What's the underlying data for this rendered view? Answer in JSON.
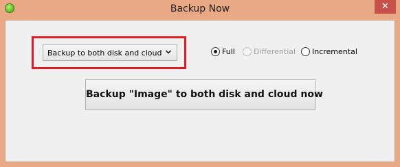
{
  "window": {
    "title": "Backup Now",
    "close_glyph": "✕"
  },
  "backup_mode": {
    "selected": "Backup to both disk and cloud"
  },
  "backup_type": {
    "options": [
      {
        "label": "Full",
        "checked": true,
        "enabled": true
      },
      {
        "label": "Differential",
        "checked": false,
        "enabled": false
      },
      {
        "label": "Incremental",
        "checked": false,
        "enabled": true
      }
    ]
  },
  "action": {
    "button_label": "Backup \"Image\" to both disk and cloud now"
  },
  "colors": {
    "title_bar": "#e9a984",
    "close_button": "#c7504b",
    "highlight": "#e01b24",
    "client_bg": "#f0f0f0"
  },
  "icons": {
    "app": "green-orb-icon",
    "close": "close-icon",
    "dropdown": "chevron-down-icon"
  }
}
